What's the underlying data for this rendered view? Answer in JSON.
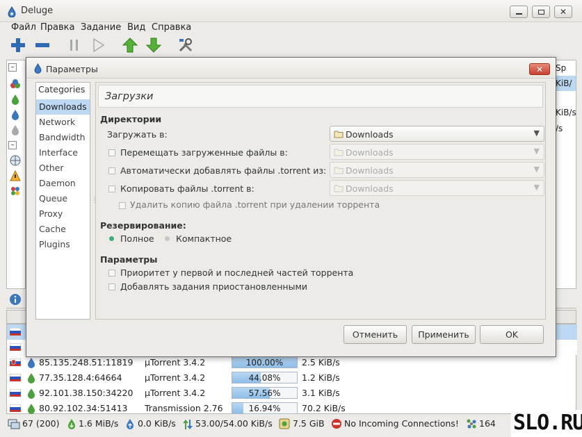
{
  "app": {
    "title": "Deluge"
  },
  "menu": [
    "Файл",
    "Правка",
    "Задание",
    "Вид",
    "Справка"
  ],
  "background": {
    "right_cells": [
      "Sp",
      "KiB/",
      "KiB/s",
      "/s"
    ]
  },
  "peers": [
    {
      "ip": "",
      "client": "",
      "progress": "",
      "speed": "",
      "flag": "ru"
    },
    {
      "ip": "",
      "client": "",
      "progress": "",
      "speed": "",
      "flag": "ru"
    },
    {
      "ip": "85.135.248.51:11819",
      "client": "µTorrent 3.4.2",
      "progress": "100.00%",
      "progress_value": 1.0,
      "speed": "2.5 KiB/s",
      "flag": "sk"
    },
    {
      "ip": "77.35.128.4:64664",
      "client": "µTorrent 3.4.2",
      "progress": "44.08%",
      "progress_value": 0.4408,
      "speed": "1.2 KiB/s",
      "flag": "ru"
    },
    {
      "ip": "92.101.38.150:34220",
      "client": "µTorrent 3.4.2",
      "progress": "57.56%",
      "progress_value": 0.5756,
      "speed": "3.1 KiB/s",
      "flag": "ru"
    },
    {
      "ip": "80.92.102.34:51413",
      "client": "Transmission 2.76",
      "progress": "16.94%",
      "progress_value": 0.1694,
      "speed": "70.2 KiB/s",
      "flag": "ru"
    }
  ],
  "status": {
    "connections": "67 (200)",
    "download": "1.6 MiB/s",
    "upload": "0.0 KiB/s",
    "protocol": "53.00/54.00 KiB/s",
    "disk": "7.5 GiB",
    "incoming": "No Incoming Connections!",
    "dht": "164"
  },
  "logo": "SLO.RU",
  "dialog": {
    "title": "Параметры",
    "categories_header": "Categories",
    "categories": [
      "Downloads",
      "Network",
      "Bandwidth",
      "Interface",
      "Other",
      "Daemon",
      "Queue",
      "Proxy",
      "Cache",
      "Plugins"
    ],
    "selected_category": "Downloads",
    "page_title": "Загрузки",
    "sections": {
      "directories": "Директории",
      "allocation": "Резервирование:",
      "options": "Параметры"
    },
    "dirs": {
      "download_to": "Загружать в:",
      "move_completed": "Перемещать загруженные файлы в:",
      "autoadd": "Автоматически добавлять файлы .torrent из:",
      "copy_torrent": "Копировать файлы .torrent в:",
      "delete_copy": "Удалить копию файла .torrent при удалении торрента",
      "folder_value": "Downloads"
    },
    "allocation": {
      "full": "Полное",
      "compact": "Компактное"
    },
    "options": {
      "prioritize": "Приоритет у первой и последней частей торрента",
      "add_paused": "Добавлять задания приостановленными"
    },
    "buttons": {
      "cancel": "Отменить",
      "apply": "Применить",
      "ok": "OK"
    }
  }
}
